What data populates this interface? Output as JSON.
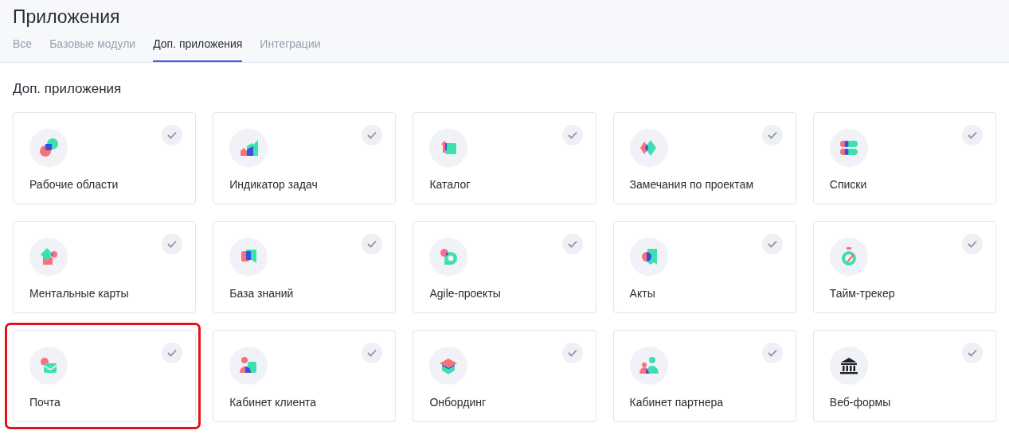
{
  "title": "Приложения",
  "tabs": [
    {
      "label": "Все",
      "selected": false
    },
    {
      "label": "Базовые модули",
      "selected": false
    },
    {
      "label": "Доп. приложения",
      "selected": true
    },
    {
      "label": "Интеграции",
      "selected": false
    }
  ],
  "section_title": "Доп. приложения",
  "apps": [
    {
      "kind": "workspaces",
      "label": "Рабочие области",
      "checked": true,
      "highlighted": false
    },
    {
      "kind": "indicator",
      "label": "Индикатор задач",
      "checked": true,
      "highlighted": false
    },
    {
      "kind": "catalog",
      "label": "Каталог",
      "checked": true,
      "highlighted": false
    },
    {
      "kind": "remarks",
      "label": "Замечания по проектам",
      "checked": true,
      "highlighted": false
    },
    {
      "kind": "lists",
      "label": "Списки",
      "checked": true,
      "highlighted": false
    },
    {
      "kind": "mindmap",
      "label": "Ментальные карты",
      "checked": true,
      "highlighted": false
    },
    {
      "kind": "knowledge",
      "label": "База знаний",
      "checked": true,
      "highlighted": false
    },
    {
      "kind": "agile",
      "label": "Agile-проекты",
      "checked": true,
      "highlighted": false
    },
    {
      "kind": "acts",
      "label": "Акты",
      "checked": true,
      "highlighted": false
    },
    {
      "kind": "timer",
      "label": "Тайм-трекер",
      "checked": true,
      "highlighted": false
    },
    {
      "kind": "mail",
      "label": "Почта",
      "checked": true,
      "highlighted": true
    },
    {
      "kind": "client",
      "label": "Кабинет клиента",
      "checked": true,
      "highlighted": false
    },
    {
      "kind": "onboarding",
      "label": "Онбординг",
      "checked": true,
      "highlighted": false
    },
    {
      "kind": "partner",
      "label": "Кабинет партнера",
      "checked": true,
      "highlighted": false
    },
    {
      "kind": "webforms",
      "label": "Веб-формы",
      "checked": true,
      "highlighted": false
    }
  ]
}
